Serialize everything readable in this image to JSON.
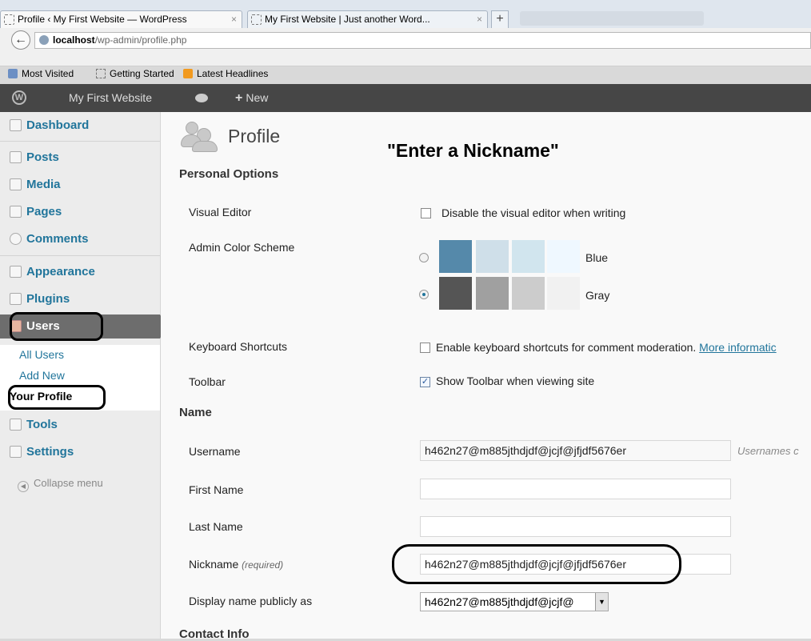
{
  "browser": {
    "tabs": [
      {
        "label": "Profile ‹ My First Website — WordPress",
        "close": "×"
      },
      {
        "label": "My First Website | Just another Word...",
        "close": "×"
      }
    ],
    "new_tab": "+",
    "back": "←",
    "url_host": "localhost",
    "url_path": "/wp-admin/profile.php",
    "bookmarks": [
      "Most Visited",
      "Getting Started",
      "Latest Headlines"
    ]
  },
  "adminbar": {
    "site_name": "My First Website",
    "new_label": "New",
    "new_plus": "+",
    "wp_logo": "W"
  },
  "sidebar": {
    "menu": [
      {
        "label": "Dashboard",
        "icon": "house-icon"
      },
      {
        "label": "Posts",
        "icon": "pushpin-icon"
      },
      {
        "label": "Media",
        "icon": "media-icon"
      },
      {
        "label": "Pages",
        "icon": "pages-icon"
      },
      {
        "label": "Comments",
        "icon": "comment-icon"
      },
      {
        "label": "Appearance",
        "icon": "appearance-icon"
      },
      {
        "label": "Plugins",
        "icon": "plugin-icon"
      },
      {
        "label": "Users",
        "icon": "users-icon"
      },
      {
        "label": "Tools",
        "icon": "tools-icon"
      },
      {
        "label": "Settings",
        "icon": "settings-icon"
      }
    ],
    "users_submenu": [
      "All Users",
      "Add New",
      "Your Profile"
    ],
    "collapse": "Collapse menu"
  },
  "page": {
    "title": "Profile",
    "annotation": "\"Enter a Nickname\"",
    "personal_options": "Personal Options",
    "visual_editor_label": "Visual Editor",
    "visual_editor_option": "Disable the visual editor when writing",
    "color_scheme_label": "Admin Color Scheme",
    "scheme_blue": "Blue",
    "scheme_gray": "Gray",
    "scheme_colors": {
      "blue": [
        "#5589aa",
        "#cfdfe9",
        "#d1e5ee",
        "#eff8ff"
      ],
      "gray": [
        "#555555",
        "#a0a0a0",
        "#cccccc",
        "#f1f1f1"
      ]
    },
    "keyboard_label": "Keyboard Shortcuts",
    "keyboard_option": "Enable keyboard shortcuts for comment moderation.",
    "keyboard_link": "More informatic",
    "toolbar_label": "Toolbar",
    "toolbar_option": "Show Toolbar when viewing site",
    "name_heading": "Name",
    "username_label": "Username",
    "username_value": "h462n27@m885jthdjdf@jcjf@jfjdf5676er",
    "username_hint": "Usernames c",
    "first_name_label": "First Name",
    "first_name_value": "",
    "last_name_label": "Last Name",
    "last_name_value": "",
    "nickname_label": "Nickname",
    "nickname_required": "(required)",
    "nickname_value": "h462n27@m885jthdjdf@jcjf@jfjdf5676er",
    "display_label": "Display name publicly as",
    "display_value": "h462n27@m885jthdjdf@jcjf@",
    "display_arrow": "▼",
    "contact_heading": "Contact Info"
  }
}
